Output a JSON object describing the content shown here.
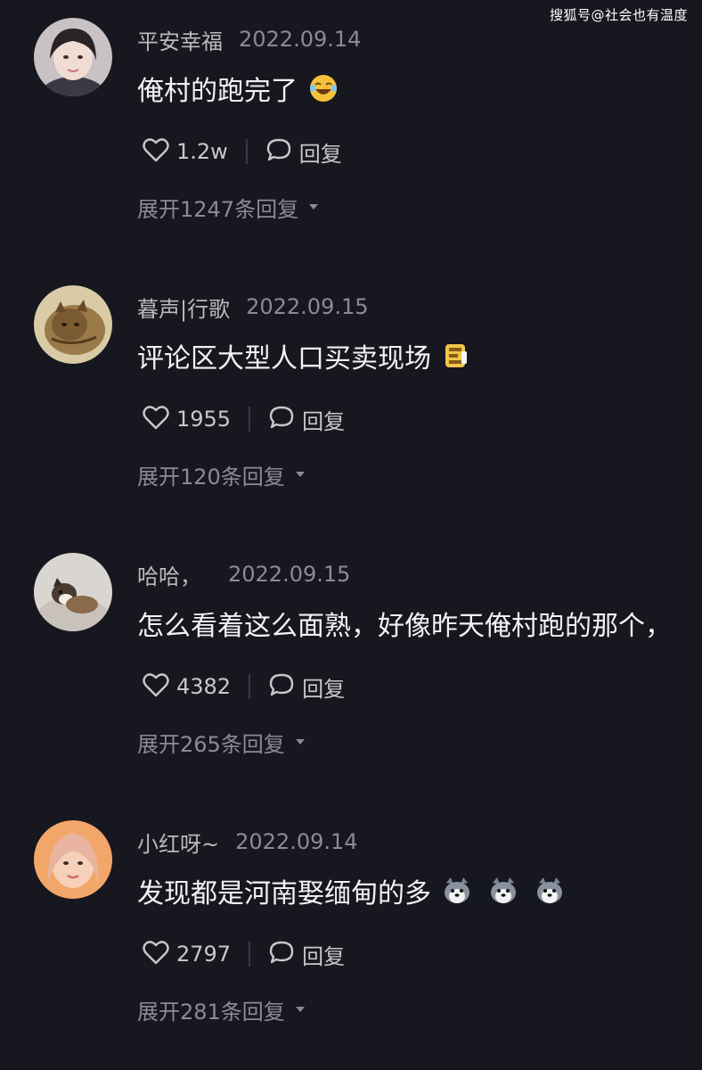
{
  "watermark": "搜狐号@社会也有温度",
  "comments": [
    {
      "username": "平安幸福",
      "date": "2022.09.14",
      "text": "俺村的跑完了",
      "emoji": "laughing-tears-emoji",
      "likes": "1.2w",
      "reply_label": "回复",
      "expand_label": "展开1247条回复",
      "avatar": "avatar-woman"
    },
    {
      "username": "暮声|行歌",
      "date": "2022.09.15",
      "text": "评论区大型人口买卖现场",
      "emoji": "shy-face-emoji",
      "likes": "1955",
      "reply_label": "回复",
      "expand_label": "展开120条回复",
      "avatar": "avatar-cat"
    },
    {
      "username": "哈哈，",
      "date": "2022.09.15",
      "text": "怎么看着这么面熟，好像昨天俺村跑的那个，",
      "emoji": "",
      "likes": "4382",
      "reply_label": "回复",
      "expand_label": "展开265条回复",
      "avatar": "avatar-dog"
    },
    {
      "username": "小红呀~",
      "date": "2022.09.14",
      "text": "发现都是河南娶缅甸的多",
      "emoji": "husky-emoji x3",
      "likes": "2797",
      "reply_label": "回复",
      "expand_label": "展开281条回复",
      "avatar": "avatar-girl"
    }
  ],
  "colors": {
    "background": "#17171f",
    "text_primary": "#f2f2f4",
    "text_secondary": "#8b8b93",
    "username": "#b9b9c0"
  }
}
